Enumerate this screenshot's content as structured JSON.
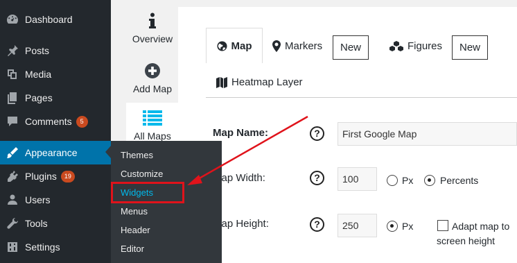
{
  "sidebar": {
    "items": [
      {
        "label": "Dashboard",
        "icon": "dashboard-icon"
      },
      {
        "label": "Posts",
        "icon": "pin-icon"
      },
      {
        "label": "Media",
        "icon": "media-icon"
      },
      {
        "label": "Pages",
        "icon": "pages-icon"
      },
      {
        "label": "Comments",
        "icon": "comment-icon",
        "badge": "5"
      },
      {
        "label": "Appearance",
        "icon": "brush-icon",
        "active": true
      },
      {
        "label": "Plugins",
        "icon": "plugin-icon",
        "badge": "19"
      },
      {
        "label": "Users",
        "icon": "users-icon"
      },
      {
        "label": "Tools",
        "icon": "wrench-icon"
      },
      {
        "label": "Settings",
        "icon": "settings-icon"
      }
    ],
    "active_color": "#0073aa",
    "bg_color": "#23282d"
  },
  "submenu": {
    "items": [
      "Themes",
      "Customize",
      "Widgets",
      "Menus",
      "Header",
      "Editor"
    ],
    "highlighted": "Widgets",
    "highlight_color": "#00b9eb"
  },
  "plugin_nav": {
    "tabs": [
      {
        "label": "Overview",
        "icon": "info-icon"
      },
      {
        "label": "Add Map",
        "icon": "plus-circle-icon"
      },
      {
        "label": "All Maps",
        "icon": "list-icon",
        "active": true
      }
    ]
  },
  "editor": {
    "tabs": {
      "map": "Map",
      "markers": "Markers",
      "markers_new": "New",
      "figures": "Figures",
      "figures_new": "New",
      "heatmap": "Heatmap Layer"
    },
    "fields": {
      "name_label": "Map Name:",
      "name_value": "First Google Map",
      "width_label": "Map Width:",
      "width_value": "100",
      "width_unit_px": "Px",
      "width_unit_percent": "Percents",
      "height_label": "Map Height:",
      "height_value": "250",
      "height_unit_px": "Px",
      "adapt_label_line1": "Adapt map to",
      "adapt_label_line2": "screen height"
    },
    "help_glyph": "?"
  },
  "annotation": {
    "color": "#e0131b"
  }
}
